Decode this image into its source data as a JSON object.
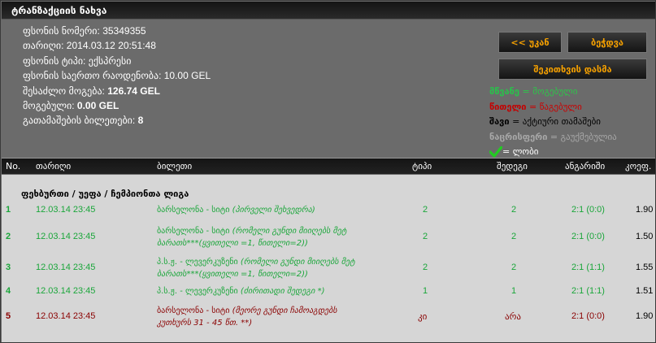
{
  "title": "ტრანზაქციის ნახვა",
  "info": [
    {
      "label": "ფსონის ნომერი:",
      "value": "35349355",
      "bold": false
    },
    {
      "label": "თარიღი:",
      "value": "2014.03.12 20:51:48",
      "bold": false
    },
    {
      "label": "ფსონის ტიპი:",
      "value": "ექსპრესი",
      "bold": false
    },
    {
      "label": "ფსონის საერთო რაოდენობა:",
      "value": "10.00 GEL",
      "bold": false
    },
    {
      "label": "შესაძლო მოგება:",
      "value": "126.74 GEL",
      "bold": true
    },
    {
      "label": "მოგებული:",
      "value": "0.00 GEL",
      "bold": true
    },
    {
      "label": "გათამაშების ბილეთები:",
      "value": "8",
      "bold": true
    }
  ],
  "buttons": {
    "back": "<< უკან",
    "print": "ბეჭდვა",
    "watch": "შეკითხვის დასმა"
  },
  "legend": {
    "green_word": "მწვანე",
    "green_text": " = მოგებული",
    "red_word": "წითელი",
    "red_text": " = წაგებული",
    "black_word": "შავი",
    "black_text": " = აქტიური თამაშები",
    "grey_word": "ნაცრისფერი",
    "grey_text": " = გაუქმებულია",
    "check_text": "= ლობი"
  },
  "table": {
    "headers": {
      "no": "No.",
      "date": "თარიღი",
      "ticket": "ბილეთი",
      "type": "ტიპი",
      "result": "შედეგი",
      "score": "ანგარიში",
      "odds": "კოეფ."
    },
    "section": "ფეხბურთი / უეფა / ჩემპიონთა ლიგა",
    "rows": [
      {
        "n": "1",
        "date": "12.03.14 23:45",
        "d1": "ბარსელონა - სიტი",
        "d2": "(პირველი შეხვედრა)",
        "d3": "",
        "type": "2",
        "res": "2",
        "score": "2:1 (0:0)",
        "odds": "1.90",
        "status": "green"
      },
      {
        "n": "2",
        "date": "12.03.14 23:45",
        "d1": "ბარსელონა - სიტი",
        "d2": "(რომელი გუნდი მიიღებს მეტ",
        "d3": "ბარათს***(ყვითელი =1, წითელი=2))",
        "type": "2",
        "res": "2",
        "score": "2:1 (0:0)",
        "odds": "1.50",
        "status": "green"
      },
      {
        "n": "3",
        "date": "12.03.14 23:45",
        "d1": "პ.ს.ჟ. - ლევერკუზენი",
        "d2": "(რომელი გუნდი მიიღებს მეტ",
        "d3": "ბარათს***(ყვითელი =1, წითელი=2))",
        "type": "2",
        "res": "2",
        "score": "2:1 (1:1)",
        "odds": "1.55",
        "status": "green"
      },
      {
        "n": "4",
        "date": "12.03.14 23:45",
        "d1": "პ.ს.ჟ. - ლევერკუზენი",
        "d2": "(ძირითადი შედეგი *)",
        "d3": "",
        "type": "1",
        "res": "1",
        "score": "2:1 (1:1)",
        "odds": "1.51",
        "status": "green"
      },
      {
        "n": "5",
        "date": "12.03.14 23:45",
        "d1": "ბარსელონა - სიტი",
        "d2": "(მეორე გუნდი ჩამოაგდებს",
        "d3": "კუთხურს 31 - 45 წთ. **)",
        "type": "კი",
        "res": "არა",
        "score": "2:1 (0:0)",
        "odds": "1.90",
        "status": "red"
      }
    ]
  }
}
